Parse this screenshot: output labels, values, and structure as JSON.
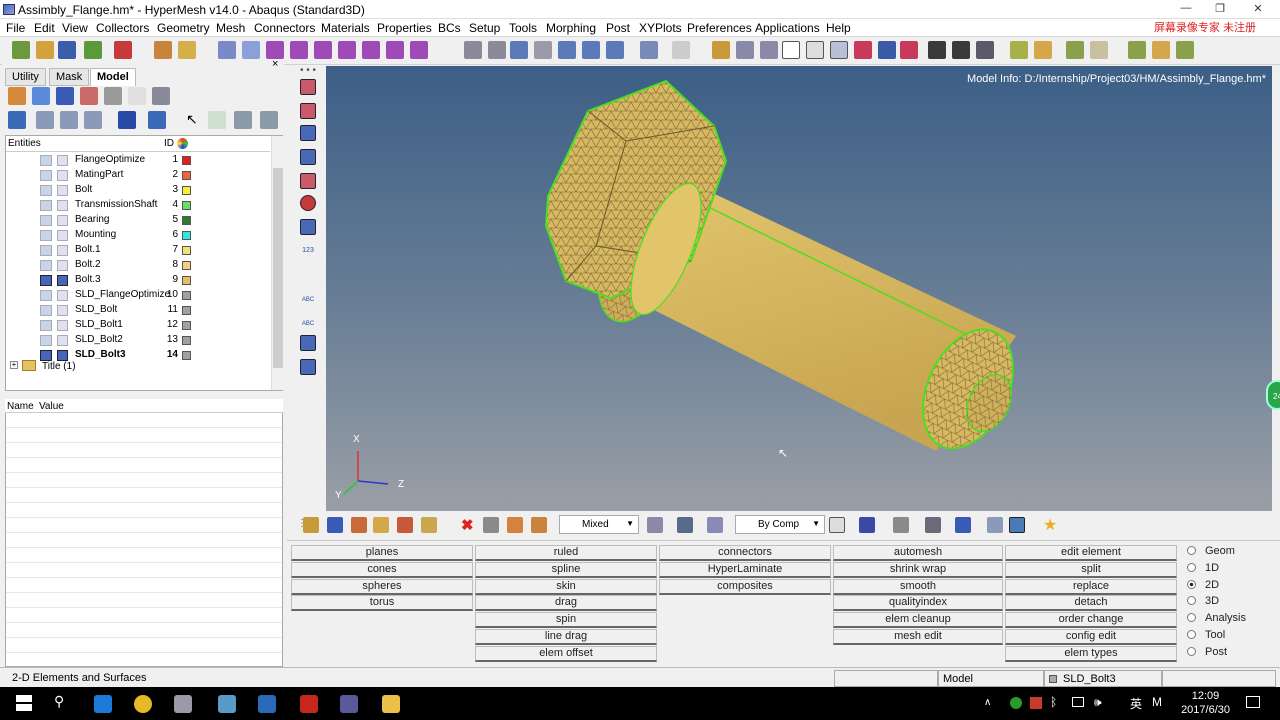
{
  "window": {
    "title": "Assimbly_Flange.hm* - HyperMesh v14.0 - Abaqus (Standard3D)",
    "min": "—",
    "max": "❐",
    "close": "✕"
  },
  "watermark": "屏幕录像专家 未注册",
  "menu": [
    "File",
    "Edit",
    "View",
    "Collectors",
    "Geometry",
    "Mesh",
    "Connectors",
    "Materials",
    "Properties",
    "BCs",
    "Setup",
    "Tools",
    "Morphing",
    "Post",
    "XYPlots",
    "Preferences",
    "Applications",
    "Help"
  ],
  "tabs": [
    "Utility",
    "Mask",
    "Model"
  ],
  "tree": {
    "col_entities": "Entities",
    "col_id": "ID",
    "rows": [
      {
        "name": "FlangeOptimize",
        "id": "1",
        "color": "#e81c1c",
        "on": false
      },
      {
        "name": "MatingPart",
        "id": "2",
        "color": "#f0643c",
        "on": false
      },
      {
        "name": "Bolt",
        "id": "3",
        "color": "#f4ee3a",
        "on": false
      },
      {
        "name": "TransmissionShaft",
        "id": "4",
        "color": "#68e068",
        "on": false
      },
      {
        "name": "Bearing",
        "id": "5",
        "color": "#2e7a2e",
        "on": false
      },
      {
        "name": "Mounting",
        "id": "6",
        "color": "#2ee8e8",
        "on": false
      },
      {
        "name": "Bolt.1",
        "id": "7",
        "color": "#f4e070",
        "on": false
      },
      {
        "name": "Bolt.2",
        "id": "8",
        "color": "#f2d07a",
        "on": false
      },
      {
        "name": "Bolt.3",
        "id": "9",
        "color": "#e0c060",
        "on": true
      },
      {
        "name": "SLD_FlangeOptimize",
        "id": "10",
        "color": "#a0a0a0",
        "on": false
      },
      {
        "name": "SLD_Bolt",
        "id": "11",
        "color": "#a0a0a0",
        "on": false
      },
      {
        "name": "SLD_Bolt1",
        "id": "12",
        "color": "#a0a0a0",
        "on": false
      },
      {
        "name": "SLD_Bolt2",
        "id": "13",
        "color": "#a0a0a0",
        "on": false
      },
      {
        "name": "SLD_Bolt3",
        "id": "14",
        "color": "#a0a0a0",
        "on": true
      }
    ],
    "title_row": "Title (1)"
  },
  "name_value": {
    "name": "Name",
    "value": "Value"
  },
  "viewport": {
    "model_info": "Model Info: D:/Internship/Project03/HM/Assimbly_Flange.hm*",
    "axis_x": "X",
    "axis_y": "Y",
    "axis_z": "Z",
    "bg_top": "#3c5e86",
    "bg_bottom": "#9a9fa6",
    "mesh_color": "#d8b860",
    "edge_color": "#48e020"
  },
  "vtool_labels": {
    "num": "123",
    "abc1": "ABC",
    "abc2": "ABC"
  },
  "bottom": {
    "mixed": "Mixed",
    "bycomp": "By Comp"
  },
  "panels": {
    "col1": [
      "planes",
      "cones",
      "spheres",
      "torus"
    ],
    "col2": [
      "ruled",
      "spline",
      "skin",
      "drag",
      "spin",
      "line drag",
      "elem offset"
    ],
    "col3": [
      "connectors",
      "HyperLaminate",
      "composites"
    ],
    "col4": [
      "automesh",
      "shrink wrap",
      "smooth",
      "qualityindex",
      "elem cleanup",
      "mesh edit"
    ],
    "col5": [
      "edit element",
      "split",
      "replace",
      "detach",
      "order change",
      "config edit",
      "elem types"
    ]
  },
  "radios": [
    {
      "label": "Geom",
      "sel": false
    },
    {
      "label": "1D",
      "sel": false
    },
    {
      "label": "2D",
      "sel": true
    },
    {
      "label": "3D",
      "sel": false
    },
    {
      "label": "Analysis",
      "sel": false
    },
    {
      "label": "Tool",
      "sel": false
    },
    {
      "label": "Post",
      "sel": false
    }
  ],
  "status": {
    "panel": "2-D Elements and Surfaces",
    "mode": "Model",
    "comp": "SLD_Bolt3"
  },
  "badge": "24",
  "taskbar": {
    "time": "12:09",
    "date": "2017/6/30",
    "ime": "英",
    "m": "M"
  }
}
